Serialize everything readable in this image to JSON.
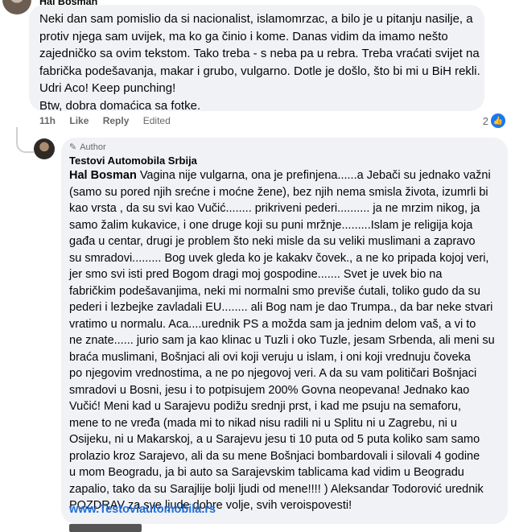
{
  "top_comment": {
    "author": "Hal Bosman",
    "lines": [
      "Neki dan sam pomislio da si nacionalist, islamomrzac, a bilo je u pitanju nasilje, a",
      "protiv njega sam uvijek, ma ko ga činio i kome. Danas vidim da imamo nešto",
      "zajedničko sa ovim tekstom. Tako treba - s neba pa u rebra. Treba vraćati svijet na",
      "fabrička podešavanja, makar i grubo, vulgarno. Dotle je došlo, što bi mi u BiH rekli.",
      "Udri Aco! Keep punching!",
      "Btw, dobra domaćica sa fotke."
    ],
    "time": "11h",
    "like_label": "Like",
    "reply_label": "Reply",
    "edited_label": "Edited",
    "reaction_count": "2"
  },
  "reply": {
    "badge": "Author",
    "author": "Testovi Automobila Srbija",
    "mention": "Hal Bosman",
    "first_line_rest": " Vagina nije vulgarna, ona je prefinjena......a Jebači su jednako važni",
    "lines": [
      "(samo su pored njih srećne i moćne žene), bez njih nema smisla života, izumrli bi",
      "kao vrsta , da su svi kao Vučić........ prikriveni pederi.......... ja ne mrzim nikog, ja",
      "samo žalim kukavice, i one druge koji su puni mržnje.........Islam je religija koja",
      "gađa u centar, drugi je problem što neki misle da su veliki muslimani a zapravo",
      "su smradovi......... Bog uvek gleda ko je kakakv čovek., a ne ko pripada kojoj veri,",
      "jer smo svi isti pred Bogom dragi moj gospodine....... Svet je uvek bio na",
      "fabričkim podešavanjima, neki mi normalni smo previše ćutali, toliko gudo da su",
      "pederi i lezbejke zavladali EU........ ali Bog nam je dao Trumpa., da bar neke stvari",
      "vratimo u normalu. Aca....urednik PS a možda sam ja jednim delom vaš, a vi to",
      "ne znate...... jurio sam ja kao klinac u Tuzli i oko Tuzle, jesam Srbenda, ali meni su",
      "braća muslimani, Bošnjaci ali ovi koji veruju u islam, i oni koji vrednuju čoveka",
      "po njegovim vrednostima, a ne po njegovoj veri. A da su vam političari Bošnjaci",
      "smradovi u Bosni, jesu i to potpisujem 200% Govna neopevana! Jednako kao",
      "Vučić! Meni kad u Sarajevu podižu srednji prst, i kad me psuju na semaforu,",
      "mene to ne vređa (mada mi to nikad nisu radili ni u Splitu ni u Zagrebu, ni u",
      "Osijeku, ni u Makarskoj, a u Sarajevu jesu ti 10 puta od 5 puta koliko sam samo",
      "prolazio kroz Sarajevo, ali da su mene Bošnjaci bombardovali i silovali 4 godine",
      "u mom Beogradu, ja bi auto sa Sarajevskim tablicama kad vidim u Beogradu",
      "zapalio, tako da su Sarajlije bolji ljudi od mene!!!! ) Aleksandar Todorović urednik",
      "POZDRAV za sve ljude dobre volje, svih veroispovesti!"
    ],
    "link": "www.Testoviautomobila.rs"
  }
}
